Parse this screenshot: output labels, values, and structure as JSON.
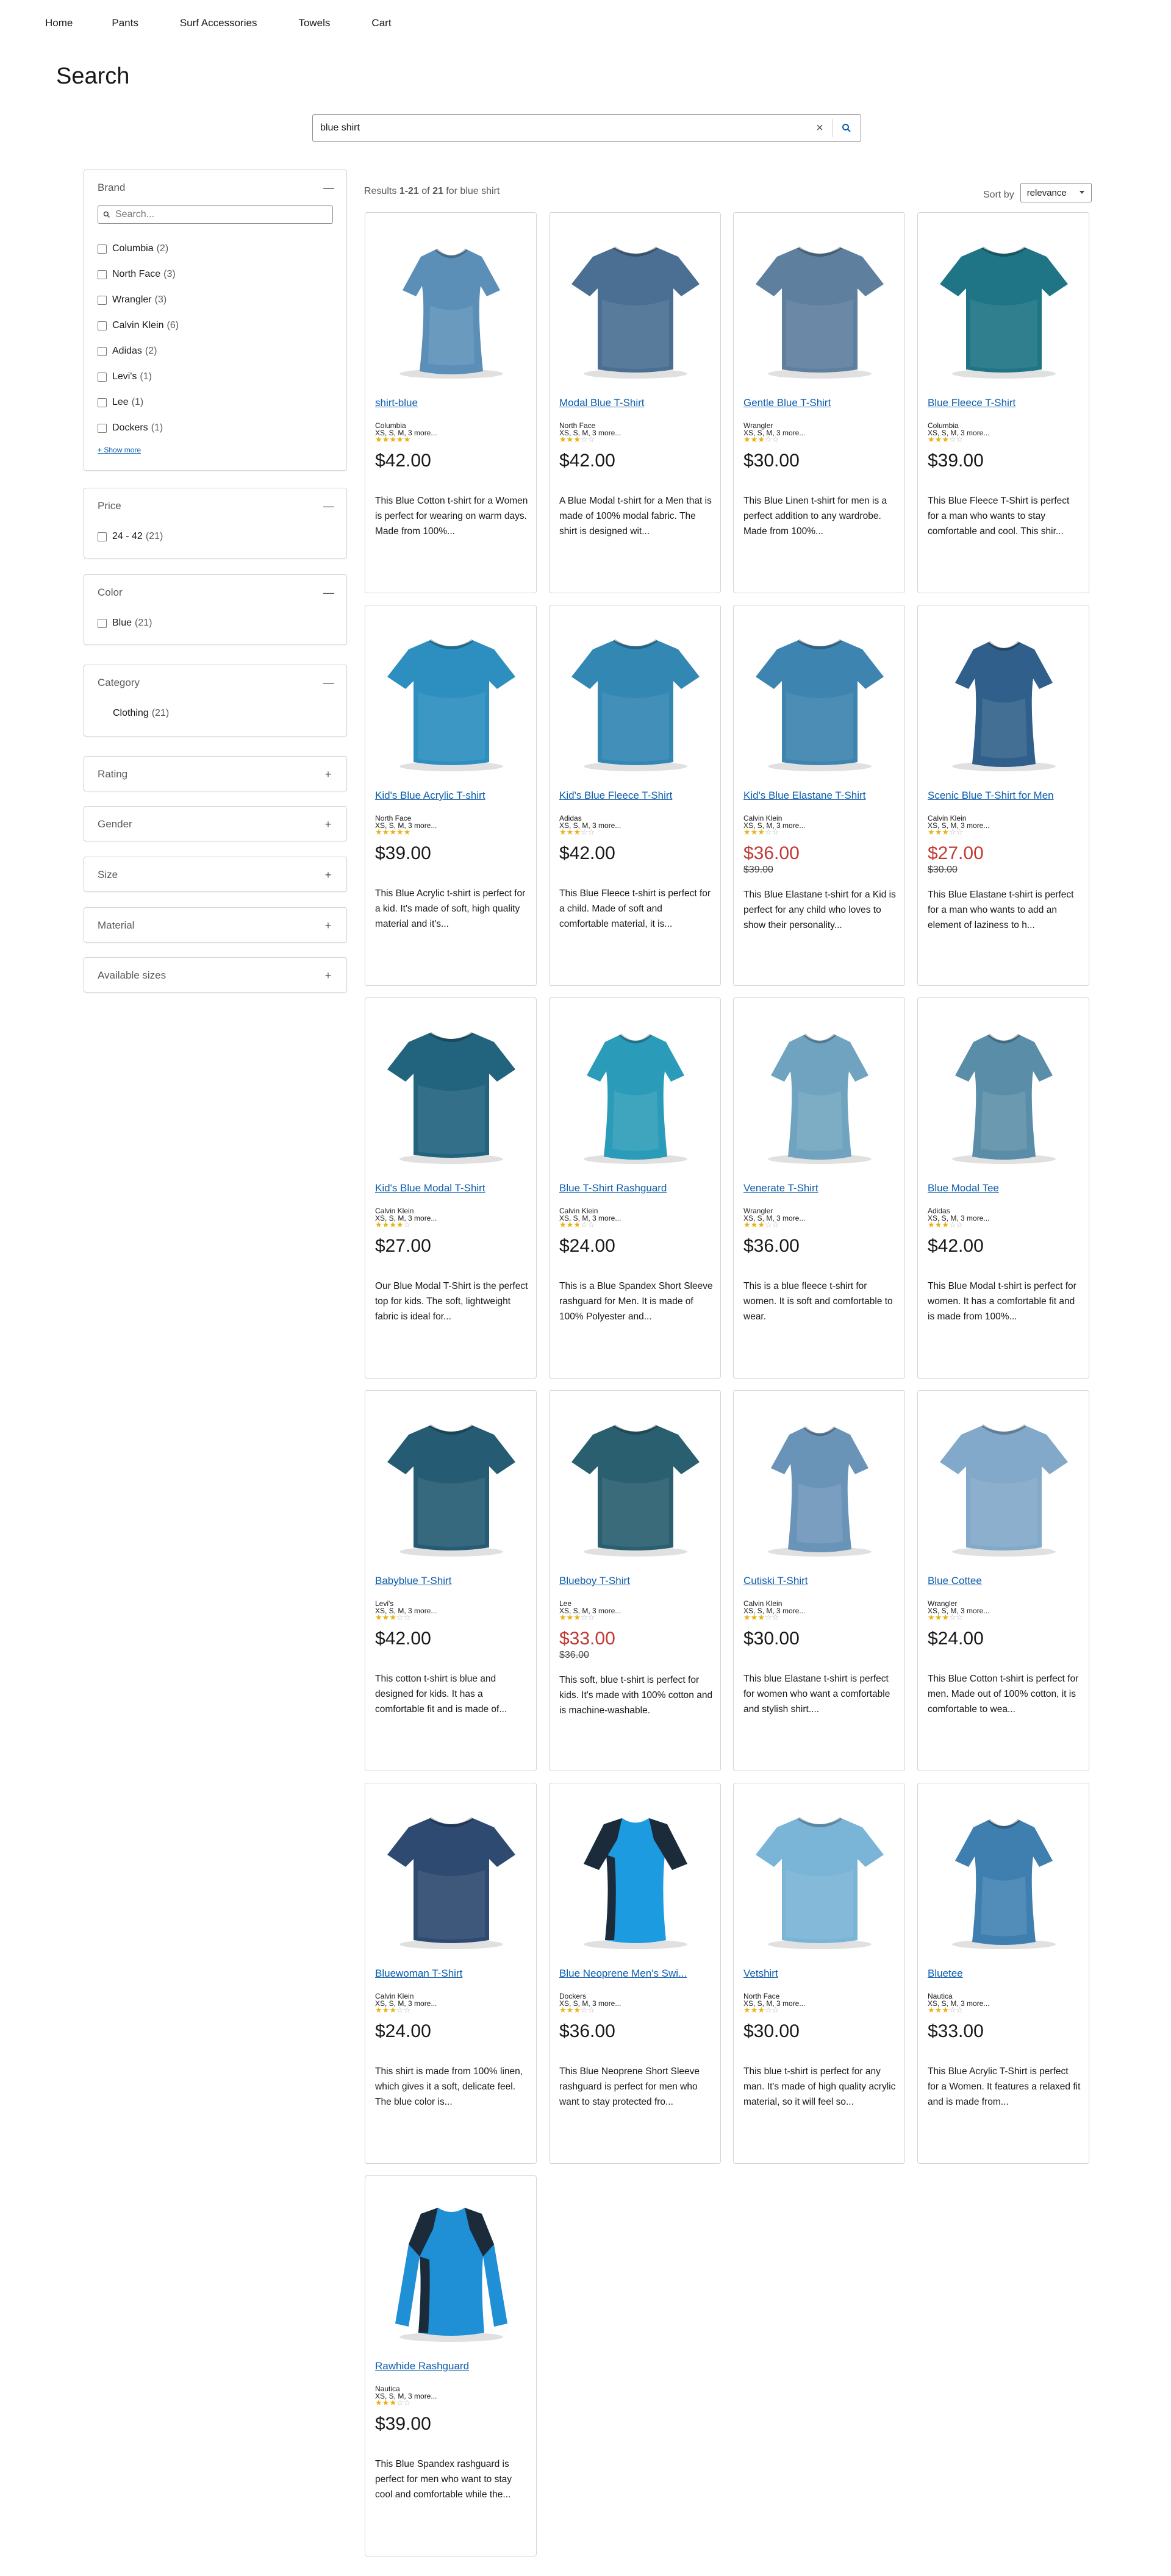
{
  "nav": [
    "Home",
    "Pants",
    "Surf Accessories",
    "Towels",
    "Cart"
  ],
  "page_title": "Search",
  "search": {
    "value": "blue shirt",
    "clear_glyph": "×"
  },
  "facets": {
    "brand": {
      "title": "Brand",
      "toggle": "—",
      "search_placeholder": "Search...",
      "options": [
        {
          "label": "Columbia",
          "count": "(2)"
        },
        {
          "label": "North Face",
          "count": "(3)"
        },
        {
          "label": "Wrangler",
          "count": "(3)"
        },
        {
          "label": "Calvin Klein",
          "count": "(6)"
        },
        {
          "label": "Adidas",
          "count": "(2)"
        },
        {
          "label": "Levi's",
          "count": "(1)"
        },
        {
          "label": "Lee",
          "count": "(1)"
        },
        {
          "label": "Dockers",
          "count": "(1)"
        }
      ],
      "show_more": "+ Show more"
    },
    "price": {
      "title": "Price",
      "toggle": "—",
      "options": [
        {
          "label": "24 - 42",
          "count": "(21)"
        }
      ]
    },
    "color": {
      "title": "Color",
      "toggle": "—",
      "options": [
        {
          "label": "Blue",
          "count": "(21)"
        }
      ]
    },
    "category": {
      "title": "Category",
      "toggle": "—",
      "options": [
        {
          "label": "Clothing",
          "count": "(21)"
        }
      ]
    },
    "collapsed": [
      {
        "title": "Rating",
        "toggle": "+"
      },
      {
        "title": "Gender",
        "toggle": "+"
      },
      {
        "title": "Size",
        "toggle": "+"
      },
      {
        "title": "Material",
        "toggle": "+"
      },
      {
        "title": "Available sizes",
        "toggle": "+"
      }
    ]
  },
  "results": {
    "prefix": "Results ",
    "range": "1-21",
    "of": " of ",
    "total": "21",
    "for": " for ",
    "query": "blue shirt"
  },
  "sort": {
    "label": "Sort by",
    "value": "relevance"
  },
  "colors": {
    "link": "#0b5cab",
    "sale": "#c23934",
    "star": "#e8b010"
  },
  "products": [
    {
      "name": "shirt-blue",
      "brand": "Columbia",
      "sizes": "XS, S, M, 3 more...",
      "rating": 5,
      "price": "$42.00",
      "orig": "",
      "desc": "This Blue Cotton t-shirt for a Women is perfect for wearing on warm days. Made from 100%...",
      "shape": "fitted",
      "color": "#5b8fb8"
    },
    {
      "name": "Modal Blue T-Shirt",
      "brand": "North Face",
      "sizes": "XS, S, M, 3 more...",
      "rating": 3,
      "price": "$42.00",
      "orig": "",
      "desc": "A Blue Modal t-shirt for a Men that is made of 100% modal fabric. The shirt is designed wit...",
      "shape": "tee",
      "color": "#4a6f93"
    },
    {
      "name": "Gentle Blue T-Shirt",
      "brand": "Wrangler",
      "sizes": "XS, S, M, 3 more...",
      "rating": 3,
      "price": "$30.00",
      "orig": "",
      "desc": "This Blue Linen t-shirt for men is a perfect addition to any wardrobe. Made from 100%...",
      "shape": "tee",
      "color": "#5f7f9f"
    },
    {
      "name": "Blue Fleece T-Shirt",
      "brand": "Columbia",
      "sizes": "XS, S, M, 3 more...",
      "rating": 3,
      "price": "$39.00",
      "orig": "",
      "desc": "This Blue Fleece T-Shirt is perfect for a man who wants to stay comfortable and cool. This shir...",
      "shape": "tee",
      "color": "#1f7585"
    },
    {
      "name": "Kid's Blue Acrylic T-shirt",
      "brand": "North Face",
      "sizes": "XS, S, M, 3 more...",
      "rating": 5,
      "price": "$39.00",
      "orig": "",
      "desc": "This Blue Acrylic t-shirt is perfect for a kid. It's made of soft, high quality material and it's...",
      "shape": "tee",
      "color": "#2c8fbf"
    },
    {
      "name": "Kid's Blue Fleece T-Shirt",
      "brand": "Adidas",
      "sizes": "XS, S, M, 3 more...",
      "rating": 3,
      "price": "$42.00",
      "orig": "",
      "desc": "This Blue Fleece t-shirt is perfect for a child. Made of soft and comfortable material, it is...",
      "shape": "tee",
      "color": "#3287b3"
    },
    {
      "name": "Kid's Blue Elastane T-Shirt",
      "brand": "Calvin Klein",
      "sizes": "XS, S, M, 3 more...",
      "rating": 3,
      "price": "$36.00",
      "orig": "$39.00",
      "desc": "This Blue Elastane t-shirt for a Kid is perfect for any child who loves to show their personality...",
      "shape": "tee",
      "color": "#3d84b0"
    },
    {
      "name": "Scenic Blue T-Shirt for Men",
      "brand": "Calvin Klein",
      "sizes": "XS, S, M, 3 more...",
      "rating": 3,
      "price": "$27.00",
      "orig": "$30.00",
      "desc": "This Blue Elastane t-shirt is perfect for a man who wants to add an element of laziness to h...",
      "shape": "fitted",
      "color": "#2f5f8a"
    },
    {
      "name": "Kid's Blue Modal T-Shirt",
      "brand": "Calvin Klein",
      "sizes": "XS, S, M, 3 more...",
      "rating": 4,
      "price": "$27.00",
      "orig": "",
      "desc": "Our Blue Modal T-Shirt is the perfect top for kids. The soft, lightweight fabric is ideal for...",
      "shape": "tee",
      "color": "#22637e"
    },
    {
      "name": "Blue T-Shirt Rashguard",
      "brand": "Calvin Klein",
      "sizes": "XS, S, M, 3 more...",
      "rating": 3,
      "price": "$24.00",
      "orig": "",
      "desc": "This is a Blue Spandex Short Sleeve rashguard for Men. It is made of 100% Polyester and...",
      "shape": "fitted",
      "color": "#2a9bb8"
    },
    {
      "name": "Venerate T-Shirt",
      "brand": "Wrangler",
      "sizes": "XS, S, M, 3 more...",
      "rating": 3,
      "price": "$36.00",
      "orig": "",
      "desc": "This is a blue fleece t-shirt for women. It is soft and comfortable to wear.",
      "shape": "fitted",
      "color": "#6fa3bf"
    },
    {
      "name": "Blue Modal Tee",
      "brand": "Adidas",
      "sizes": "XS, S, M, 3 more...",
      "rating": 3,
      "price": "$42.00",
      "orig": "",
      "desc": "This Blue Modal t-shirt is perfect for women. It has a comfortable fit and is made from 100%...",
      "shape": "fitted",
      "color": "#5a8ea8"
    },
    {
      "name": "Babyblue T-Shirt",
      "brand": "Levi's",
      "sizes": "XS, S, M, 3 more...",
      "rating": 3,
      "price": "$42.00",
      "orig": "",
      "desc": "This cotton t-shirt is blue and designed for kids. It has a comfortable fit and is made of...",
      "shape": "tee",
      "color": "#255c73"
    },
    {
      "name": "Blueboy T-Shirt",
      "brand": "Lee",
      "sizes": "XS, S, M, 3 more...",
      "rating": 3,
      "price": "$33.00",
      "orig": "$36.00",
      "desc": "This soft, blue t-shirt is perfect for kids. It's made with 100% cotton and is machine-washable.",
      "shape": "tee",
      "color": "#2a5f70"
    },
    {
      "name": "Cutiski T-Shirt",
      "brand": "Calvin Klein",
      "sizes": "XS, S, M, 3 more...",
      "rating": 3,
      "price": "$30.00",
      "orig": "",
      "desc": "This blue Elastane t-shirt is perfect for women who want a comfortable and stylish shirt....",
      "shape": "fitted",
      "color": "#6a93b8"
    },
    {
      "name": "Blue Cottee",
      "brand": "Wrangler",
      "sizes": "XS, S, M, 3 more...",
      "rating": 3,
      "price": "$24.00",
      "orig": "",
      "desc": "This Blue Cotton t-shirt is perfect for men. Made out of 100% cotton, it is comfortable to wea...",
      "shape": "tee",
      "color": "#82a9c9"
    },
    {
      "name": "Bluewoman T-Shirt",
      "brand": "Calvin Klein",
      "sizes": "XS, S, M, 3 more...",
      "rating": 3,
      "price": "$24.00",
      "orig": "",
      "desc": "This shirt is made from 100% linen, which gives it a soft, delicate feel. The blue color is...",
      "shape": "tee",
      "color": "#2e4a70"
    },
    {
      "name": "Blue Neoprene Men's Swi...",
      "brand": "Dockers",
      "sizes": "XS, S, M, 3 more...",
      "rating": 3,
      "price": "$36.00",
      "orig": "",
      "desc": "This Blue Neoprene Short Sleeve rashguard is perfect for men who want to stay protected fro...",
      "shape": "rash",
      "color": "#1c9be0"
    },
    {
      "name": "Vetshirt",
      "brand": "North Face",
      "sizes": "XS, S, M, 3 more...",
      "rating": 3,
      "price": "$30.00",
      "orig": "",
      "desc": "This blue t-shirt is perfect for any man. It's made of high quality acrylic material, so it will feel so...",
      "shape": "tee",
      "color": "#7ab4d6"
    },
    {
      "name": "Bluetee",
      "brand": "Nautica",
      "sizes": "XS, S, M, 3 more...",
      "rating": 3,
      "price": "$33.00",
      "orig": "",
      "desc": "This Blue Acrylic T-Shirt is perfect for a Women. It features a relaxed fit and is made from...",
      "shape": "fitted",
      "color": "#3f7fb0"
    },
    {
      "name": "Rawhide Rashguard",
      "brand": "Nautica",
      "sizes": "XS, S, M, 3 more...",
      "rating": 3,
      "price": "$39.00",
      "orig": "",
      "desc": "This Blue Spandex rashguard is perfect for men who want to stay cool and comfortable while the...",
      "shape": "longrash",
      "color": "#1f8fd6"
    }
  ]
}
